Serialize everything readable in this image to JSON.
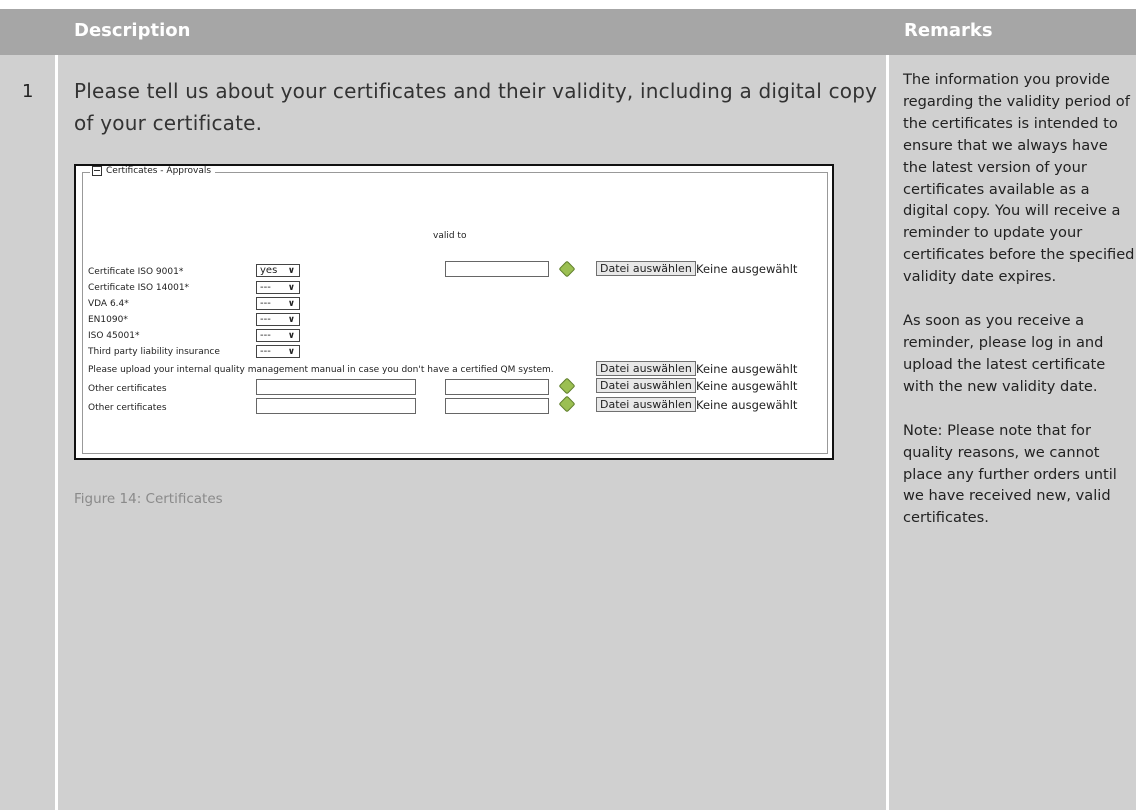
{
  "header": {
    "description": "Description",
    "remarks": "Remarks"
  },
  "row": {
    "number": "1",
    "description": "Please tell us about your certificates and their validity, including a digital copy of your certificate.",
    "caption": "Figure 14: Certificates",
    "remarks": [
      "The information you provide regarding the validity period of the certificates is intended to ensure that we always have the latest version of your certificates available as a digital copy. You will receive a reminder to update your certificates before the specified validity date expires.",
      "As soon as you receive a reminder, please log in and upload the latest certificate with the new validity date.",
      "Note: Please note that for quality reasons, we cannot place any further orders until we have received new, valid certificates."
    ]
  },
  "form": {
    "legend": "Certificates - Approvals",
    "valid_to": "valid to",
    "file_button": "Datei auswählen",
    "no_file": "Keine ausgewählt",
    "rows": [
      {
        "label": "Certificate ISO 9001*",
        "select": "yes"
      },
      {
        "label": "Certificate ISO 14001*",
        "select": "---"
      },
      {
        "label": "VDA 6.4*",
        "select": "---"
      },
      {
        "label": "EN1090*",
        "select": "---"
      },
      {
        "label": "ISO 45001*",
        "select": "---"
      },
      {
        "label": "Third party liability insurance",
        "select": "---"
      }
    ],
    "upload_label": "Please upload your internal quality management manual in case you don't have a certified QM system.",
    "other_label_1": "Other certificates",
    "other_label_2": "Other certificates"
  }
}
